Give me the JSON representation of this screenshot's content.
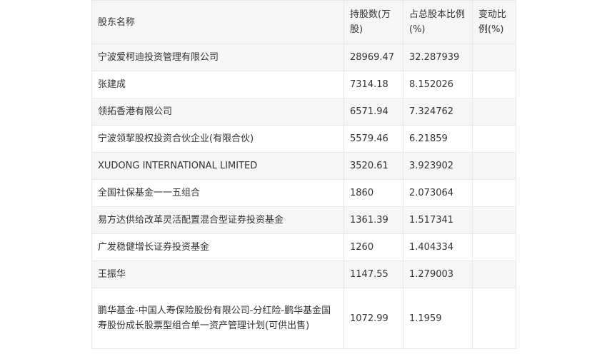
{
  "table": {
    "headers": [
      "股东名称",
      "持股数(万股)",
      "占总股本比例(%)",
      "变动比例(%)"
    ],
    "rows": [
      [
        "宁波爱柯迪投资管理有限公司",
        "28969.47",
        "32.287939",
        ""
      ],
      [
        "张建成",
        "7314.18",
        "8.152026",
        ""
      ],
      [
        "领拓香港有限公司",
        "6571.94",
        "7.324762",
        ""
      ],
      [
        "宁波领挈股权投资合伙企业(有限合伙)",
        "5579.46",
        "6.21859",
        ""
      ],
      [
        "XUDONG INTERNATIONAL LIMITED",
        "3520.61",
        "3.923902",
        ""
      ],
      [
        "全国社保基金一一五组合",
        "1860",
        "2.073064",
        ""
      ],
      [
        "易方达供给改革灵活配置混合型证券投资基金",
        "1361.39",
        "1.517341",
        ""
      ],
      [
        "广发稳健增长证券投资基金",
        "1260",
        "1.404334",
        ""
      ],
      [
        "王振华",
        "1147.55",
        "1.279003",
        ""
      ],
      [
        "鹏华基金-中国人寿保险股份有限公司-分红险-鹏华基金国寿股份成长股票型组合单一资产管理计划(可供出售)",
        "1072.99",
        "1.1959",
        ""
      ]
    ]
  }
}
